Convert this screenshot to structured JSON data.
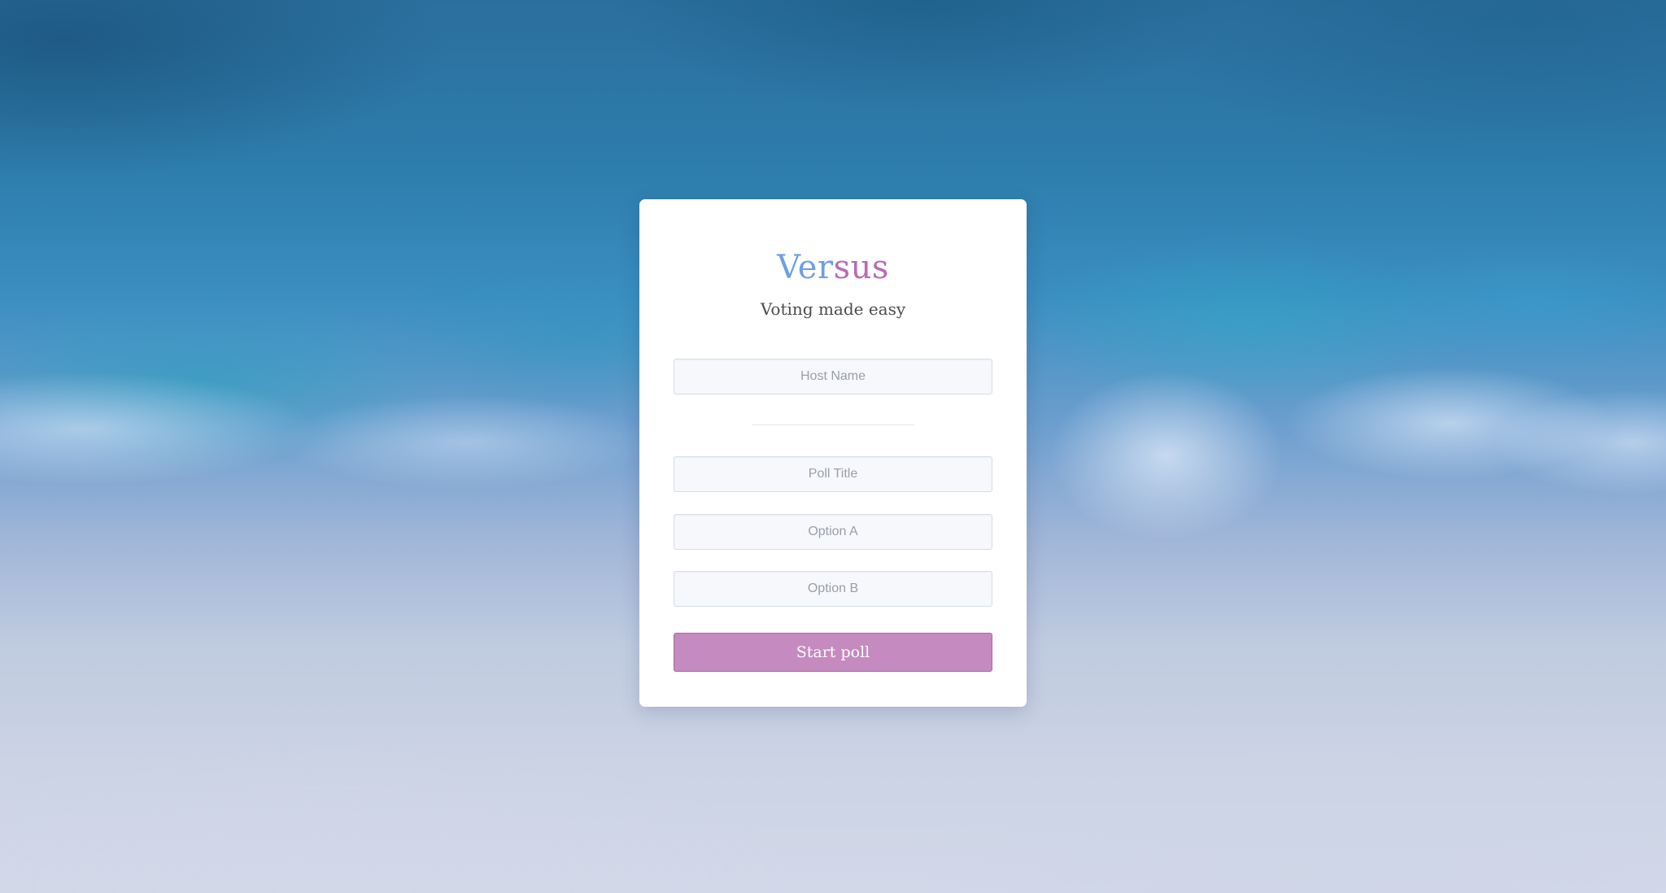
{
  "background": {
    "description_icon": "ocean-waves-photo"
  },
  "brand": {
    "part_a": "Ver",
    "part_b": "sus",
    "colors": {
      "part_a": "#6f9ee6",
      "part_b": "#b86bb1"
    }
  },
  "tagline": "Voting made easy",
  "form": {
    "host_name": {
      "placeholder": "Host Name",
      "value": ""
    },
    "poll_title": {
      "placeholder": "Poll Title",
      "value": ""
    },
    "option_a": {
      "placeholder": "Option A",
      "value": ""
    },
    "option_b": {
      "placeholder": "Option B",
      "value": ""
    },
    "submit_label": "Start poll",
    "submit_color": "#c58abf"
  }
}
